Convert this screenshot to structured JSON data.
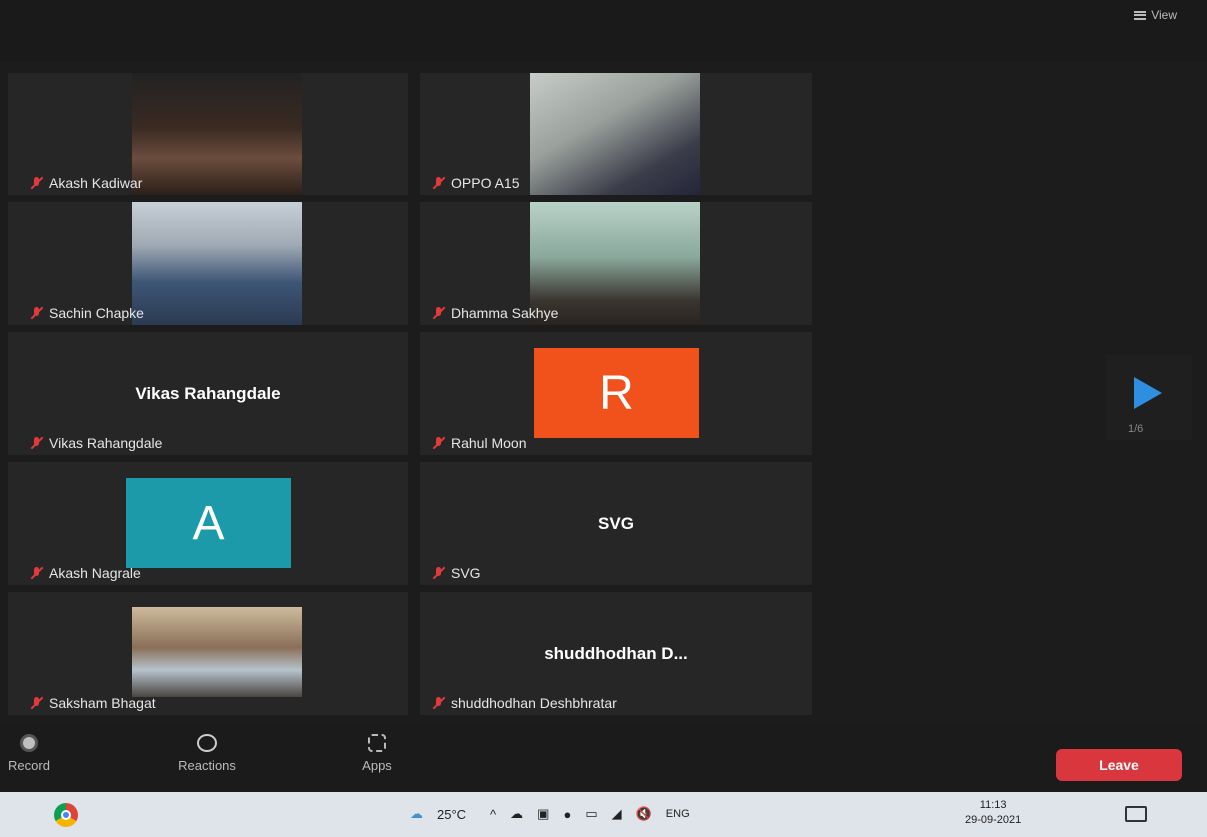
{
  "header": {
    "view_label": "View"
  },
  "participants": [
    {
      "name": "Akash Kadiwar",
      "kind": "video",
      "bg": "#3a2a22"
    },
    {
      "name": "OPPO A15",
      "kind": "video",
      "bg": "#8a8c8a"
    },
    {
      "name": "Sachin Chapke",
      "kind": "video",
      "bg": "#6a7f96"
    },
    {
      "name": "Dhamma Sakhye",
      "kind": "video",
      "bg": "#7a9c92"
    },
    {
      "name": "Vikas Rahangdale",
      "kind": "name",
      "display": "Vikas Rahangdale"
    },
    {
      "name": "Rahul Moon",
      "kind": "avatar",
      "letter": "R",
      "color": "#f1511b"
    },
    {
      "name": "Akash Nagrale",
      "kind": "avatar",
      "letter": "A",
      "color": "#1d9aaa"
    },
    {
      "name": "SVG",
      "kind": "name",
      "display": "SVG"
    },
    {
      "name": "Saksham Bhagat",
      "kind": "video",
      "bg": "#8a6f57"
    },
    {
      "name": "shuddhodhan Deshbhratar",
      "kind": "name",
      "display": "shuddhodhan  D..."
    }
  ],
  "pager": {
    "count": "1/6"
  },
  "controls": {
    "record": "Record",
    "reactions": "Reactions",
    "apps": "Apps",
    "leave": "Leave"
  },
  "taskbar": {
    "temperature": "25°C",
    "language": "ENG",
    "time": "11:13",
    "date": "29-09-2021"
  }
}
